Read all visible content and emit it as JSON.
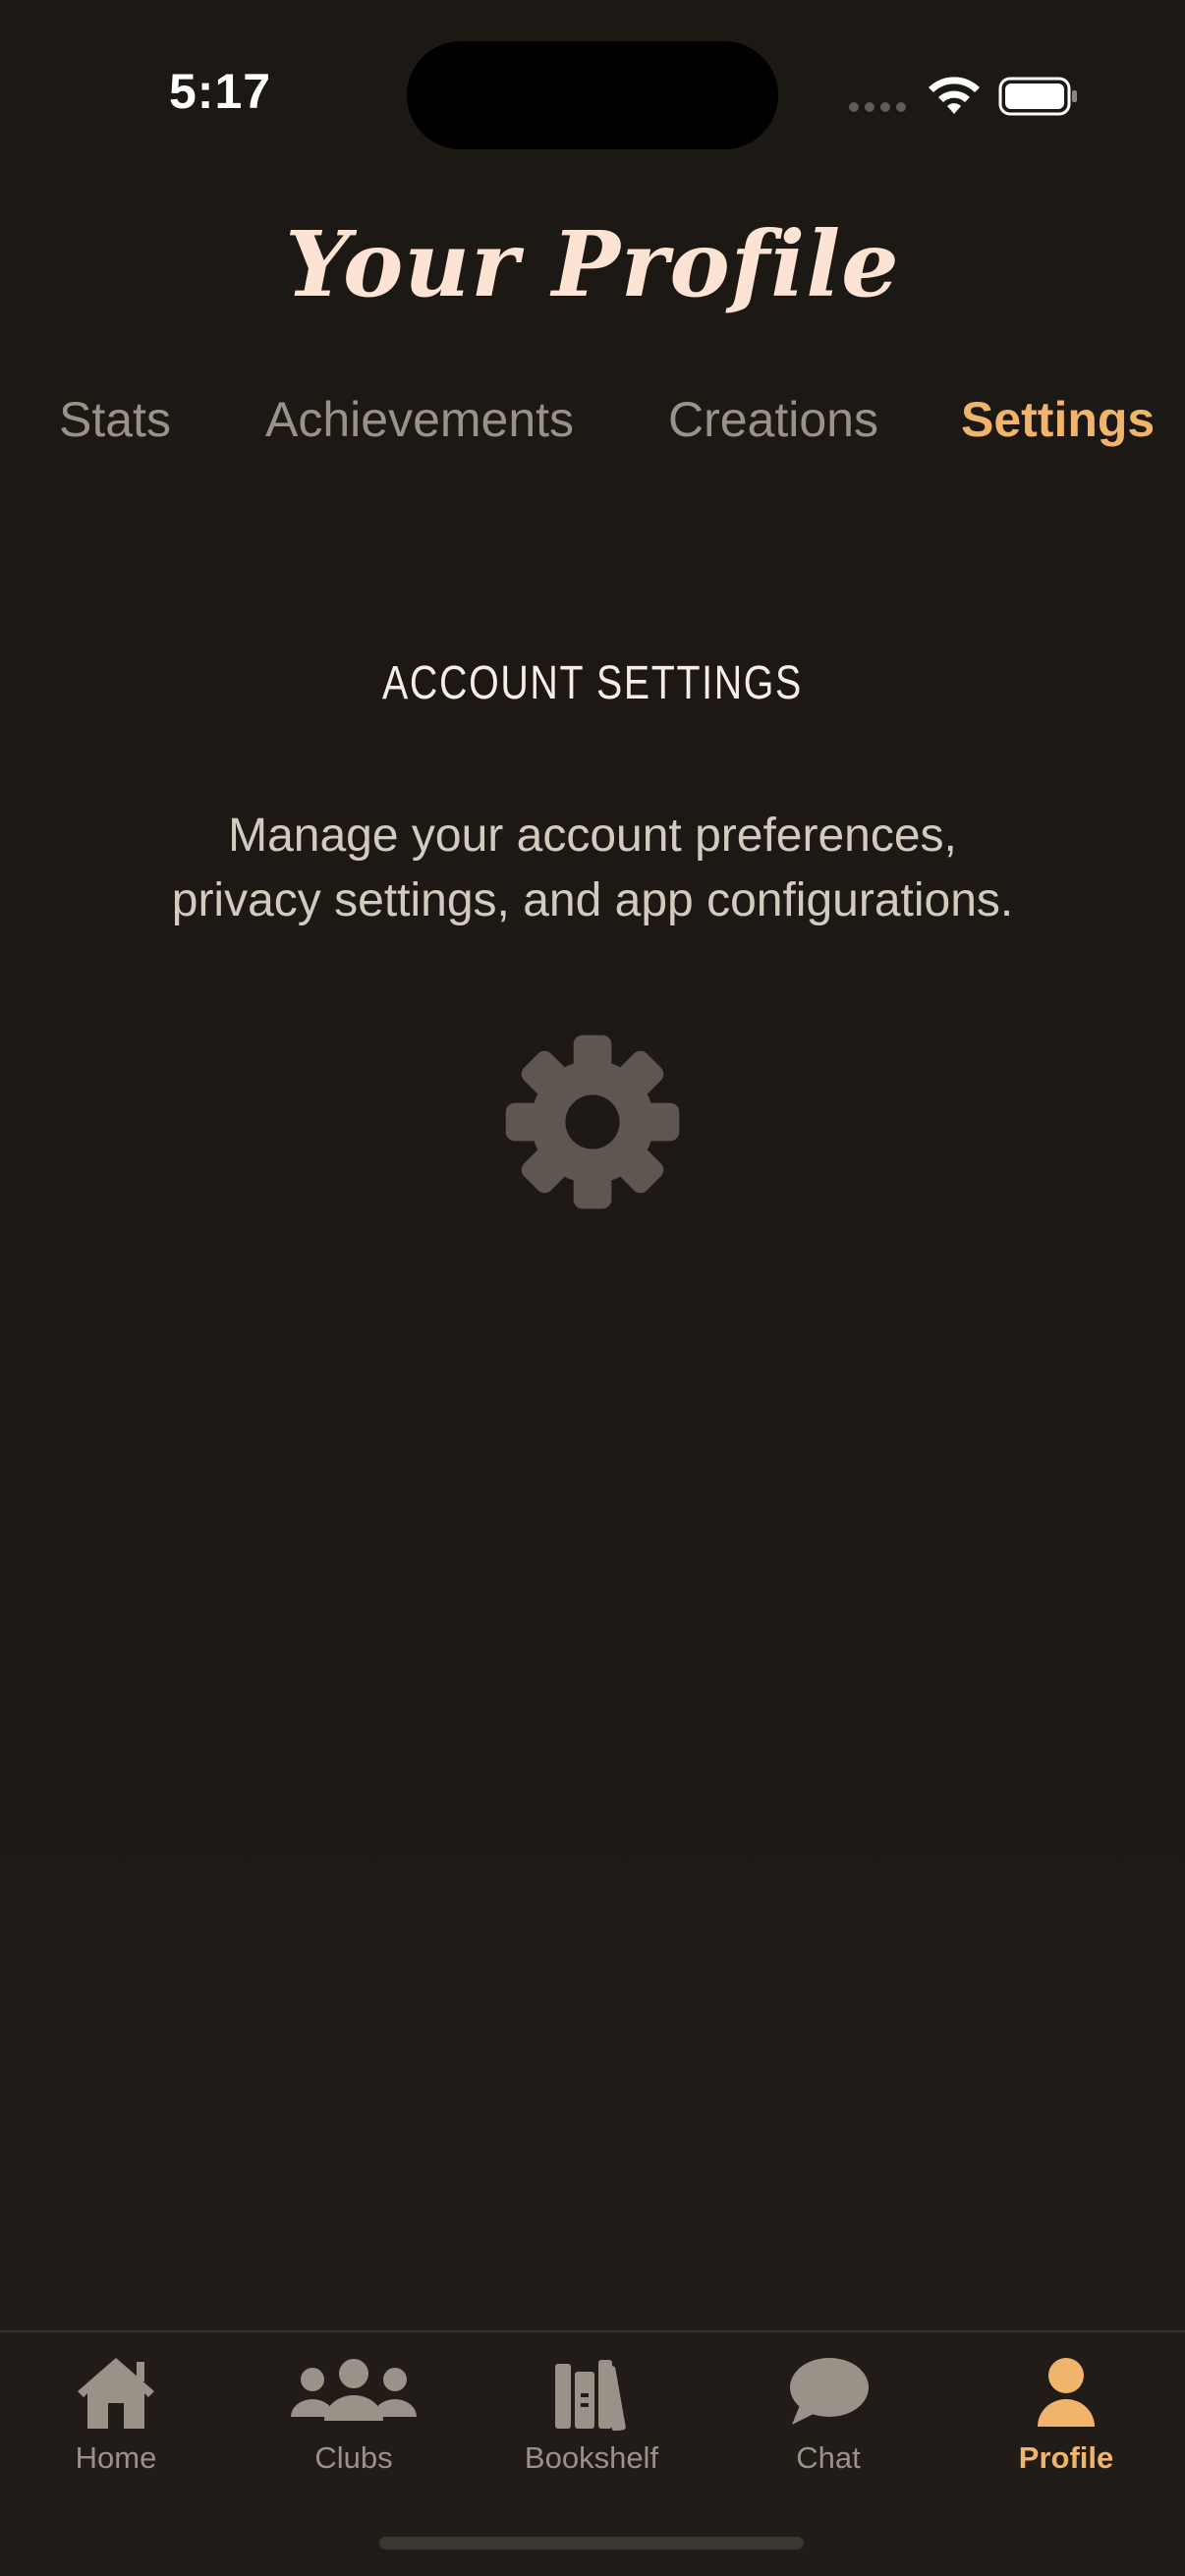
{
  "status_bar": {
    "time": "5:17",
    "icons": [
      "signal-dots-icon",
      "wifi-icon",
      "battery-icon"
    ]
  },
  "header": {
    "title": "Your Profile"
  },
  "tabs": [
    {
      "label": "Stats",
      "active": false
    },
    {
      "label": "Achievements",
      "active": false
    },
    {
      "label": "Creations",
      "active": false
    },
    {
      "label": "Settings",
      "active": true
    }
  ],
  "content": {
    "section_title": "ACCOUNT SETTINGS",
    "description_line1": "Manage your account preferences,",
    "description_line2": "privacy settings, and app configurations.",
    "icon": "gear-icon"
  },
  "tabbar": [
    {
      "label": "Home",
      "icon": "home-icon",
      "active": false
    },
    {
      "label": "Clubs",
      "icon": "clubs-icon",
      "active": false
    },
    {
      "label": "Bookshelf",
      "icon": "bookshelf-icon",
      "active": false
    },
    {
      "label": "Chat",
      "icon": "chat-bubble-icon",
      "active": false
    },
    {
      "label": "Profile",
      "icon": "person-icon",
      "active": true
    }
  ],
  "colors": {
    "background": "#1c1814",
    "accent": "#f0b46b",
    "title": "#fde3d3",
    "muted_text": "#9a9188",
    "icon_muted": "#5e5650"
  }
}
